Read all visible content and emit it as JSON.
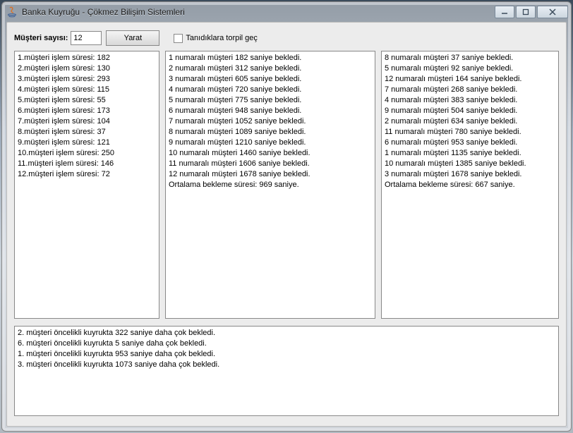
{
  "window": {
    "title": "Banka Kuyruğu - Çökmez Bilişim Sistemleri"
  },
  "controls": {
    "count_label": "Müşteri sayısı:",
    "count_value": "12",
    "create_label": "Yarat",
    "torpil_label": "Tanıdıklara torpil geç",
    "torpil_checked": false
  },
  "panel_left": "1.müşteri işlem süresi: 182\n2.müşteri işlem süresi: 130\n3.müşteri işlem süresi: 293\n4.müşteri işlem süresi: 115\n5.müşteri işlem süresi: 55\n6.müşteri işlem süresi: 173\n7.müşteri işlem süresi: 104\n8.müşteri işlem süresi: 37\n9.müşteri işlem süresi: 121\n10.müşteri işlem süresi: 250\n11.müşteri işlem süresi: 146\n12.müşteri işlem süresi: 72",
  "panel_mid": "1 numaralı müşteri 182 saniye bekledi.\n2 numaralı müşteri 312 saniye bekledi.\n3 numaralı müşteri 605 saniye bekledi.\n4 numaralı müşteri 720 saniye bekledi.\n5 numaralı müşteri 775 saniye bekledi.\n6 numaralı müşteri 948 saniye bekledi.\n7 numaralı müşteri 1052 saniye bekledi.\n8 numaralı müşteri 1089 saniye bekledi.\n9 numaralı müşteri 1210 saniye bekledi.\n10 numaralı müşteri 1460 saniye bekledi.\n11 numaralı müşteri 1606 saniye bekledi.\n12 numaralı müşteri 1678 saniye bekledi.\nOrtalama bekleme süresi: 969 saniye.",
  "panel_right": "8 numaralı müşteri 37 saniye bekledi.\n5 numaralı müşteri 92 saniye bekledi.\n12 numaralı müşteri 164 saniye bekledi.\n7 numaralı müşteri 268 saniye bekledi.\n4 numaralı müşteri 383 saniye bekledi.\n9 numaralı müşteri 504 saniye bekledi.\n2 numaralı müşteri 634 saniye bekledi.\n11 numaralı müşteri 780 saniye bekledi.\n6 numaralı müşteri 953 saniye bekledi.\n1 numaralı müşteri 1135 saniye bekledi.\n10 numaralı müşteri 1385 saniye bekledi.\n3 numaralı müşteri 1678 saniye bekledi.\nOrtalama bekleme süresi: 667 saniye.",
  "panel_bottom": "2. müşteri öncelikli kuyrukta 322 saniye daha çok bekledi.\n6. müşteri öncelikli kuyrukta 5 saniye daha çok bekledi.\n1. müşteri öncelikli kuyrukta 953 saniye daha çok bekledi.\n3. müşteri öncelikli kuyrukta 1073 saniye daha çok bekledi."
}
